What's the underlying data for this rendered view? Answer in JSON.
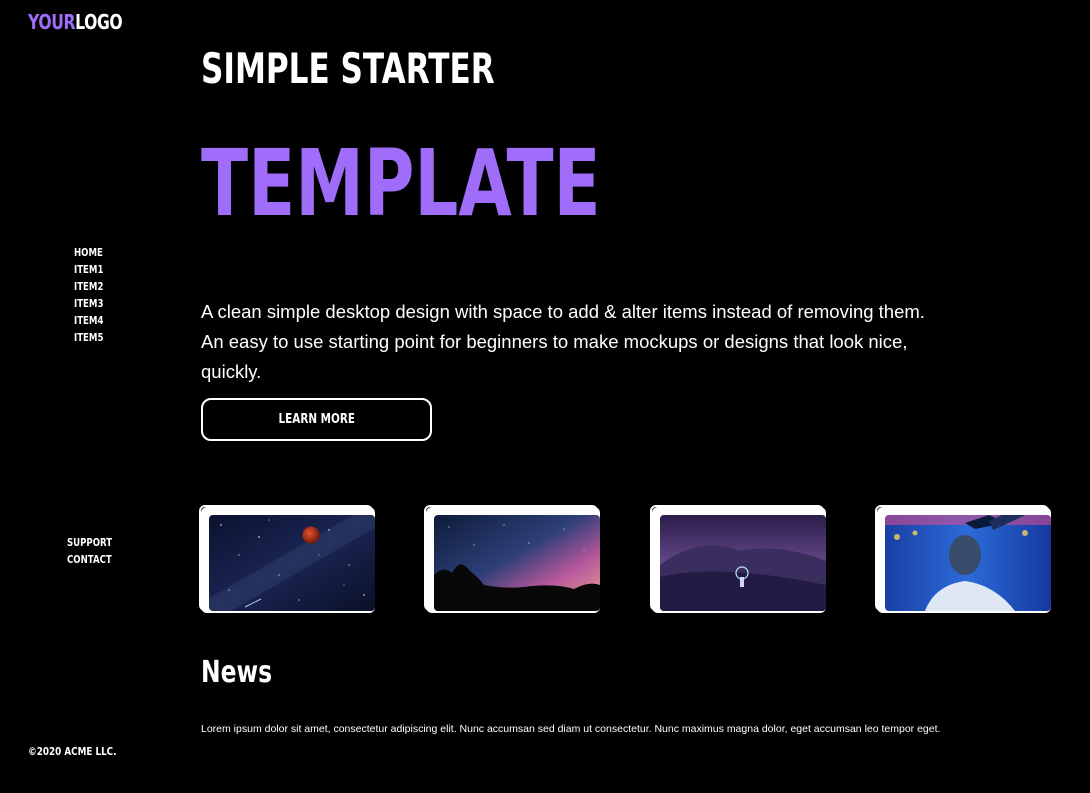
{
  "logo": {
    "accent": "YOUR",
    "plain": "LOGO"
  },
  "nav": {
    "items": [
      {
        "label": "HOME"
      },
      {
        "label": "ITEM1"
      },
      {
        "label": "ITEM2"
      },
      {
        "label": "ITEM3"
      },
      {
        "label": "ITEM4"
      },
      {
        "label": "ITEM5"
      }
    ],
    "secondary": [
      {
        "label": "SUPPORT"
      },
      {
        "label": "CONTACT"
      }
    ]
  },
  "hero": {
    "subtitle": "SIMPLE STARTER",
    "title": "TEMPLATE",
    "body": "A clean simple desktop design with space to add & alter items instead of removing them. An easy to use starting point for beginners to make mockups or designs that look nice, quickly.",
    "cta_label": "LEARN MORE"
  },
  "cards": [
    {
      "icon": "blood-moon-milky-way-image"
    },
    {
      "icon": "starry-sky-rocks-image"
    },
    {
      "icon": "snowy-mountain-night-image"
    },
    {
      "icon": "neon-portrait-image"
    }
  ],
  "news": {
    "title": "News",
    "text": "Lorem ipsum dolor sit amet, consectetur adipiscing elit. Nunc accumsan sed diam ut consectetur. Nunc maximus magna dolor, eget accumsan leo tempor eget."
  },
  "footer": {
    "copyright": "©2020 ACME LLC."
  },
  "colors": {
    "accent": "#a06dfa",
    "background": "#000000",
    "text": "#ffffff"
  }
}
